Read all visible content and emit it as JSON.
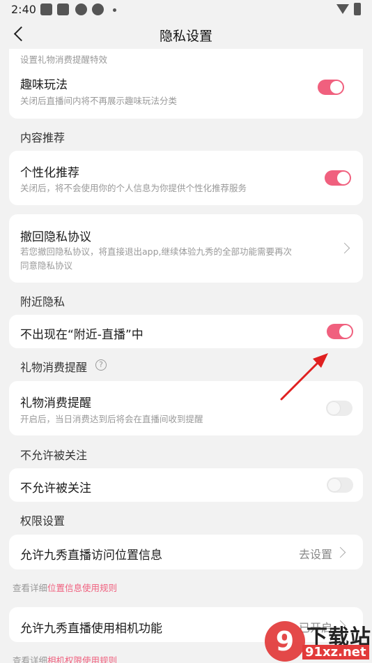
{
  "status_bar": {
    "time": "2:40"
  },
  "nav": {
    "title": "隐私设置"
  },
  "gift_effect": {
    "subtitle": "设置礼物消费提醒特效",
    "toggle_on": true
  },
  "fun_play": {
    "title": "趣味玩法",
    "subtitle": "关闭后直播间内将不再展示趣味玩法分类",
    "toggle_on": true
  },
  "content_recommend": {
    "section": "内容推荐",
    "title": "个性化推荐",
    "subtitle": "关闭后，将不会使用你的个人信息为你提供个性化推荐服务",
    "toggle_on": true
  },
  "revoke_privacy": {
    "title": "撤回隐私协议",
    "subtitle_line1": "若您撤回隐私协议，将直接退出app,继续体验九秀的全部功能需要再次",
    "subtitle_line2": "同意隐私协议"
  },
  "nearby": {
    "section": "附近隐私",
    "title": "不出现在“附近-直播”中",
    "toggle_on": true
  },
  "gift_reminder": {
    "section": "礼物消费提醒",
    "help_icon": "?",
    "title": "礼物消费提醒",
    "subtitle": "开启后，当日消费达到后将会在直播间收到提醒",
    "toggle_on": false
  },
  "no_follow": {
    "section": "不允许被关注",
    "title": "不允许被关注",
    "toggle_on": false
  },
  "permissions": {
    "section": "权限设置",
    "location": {
      "title": "允许九秀直播访问位置信息",
      "action": "去设置"
    },
    "location_note": {
      "prefix": "查看详细",
      "link": "位置信息使用规则"
    },
    "camera": {
      "title": "允许九秀直播使用相机功能",
      "action": "已开启"
    },
    "camera_note": {
      "prefix": "查看详细",
      "link": "相机权限使用规则"
    }
  },
  "watermark": {
    "logo_text": "9",
    "cn_text": "下载站",
    "url": "91xz.net"
  },
  "colors": {
    "accent": "#f0607e",
    "background": "#f2f2f2",
    "card": "#ffffff",
    "annotation_arrow": "#e02020"
  }
}
